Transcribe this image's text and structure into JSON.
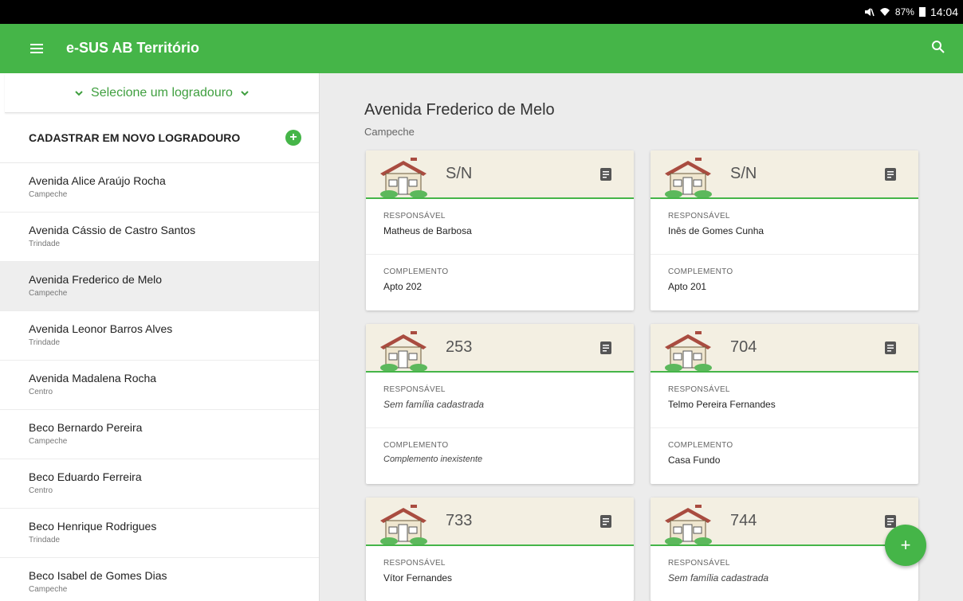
{
  "status": {
    "battery": "87%",
    "time": "14:04"
  },
  "appbar": {
    "title": "e-SUS AB Território"
  },
  "sidebar": {
    "selector_label": "Selecione um logradouro",
    "new_label": "CADASTRAR EM NOVO LOGRADOURO",
    "items": [
      {
        "name": "Avenida Alice Araújo Rocha",
        "sub": "Campeche"
      },
      {
        "name": "Avenida Cássio de Castro Santos",
        "sub": "Trindade"
      },
      {
        "name": "Avenida Frederico de Melo",
        "sub": "Campeche"
      },
      {
        "name": "Avenida Leonor Barros Alves",
        "sub": "Trindade"
      },
      {
        "name": "Avenida Madalena Rocha",
        "sub": "Centro"
      },
      {
        "name": "Beco Bernardo Pereira",
        "sub": "Campeche"
      },
      {
        "name": "Beco Eduardo Ferreira",
        "sub": "Centro"
      },
      {
        "name": "Beco Henrique Rodrigues",
        "sub": "Trindade"
      },
      {
        "name": "Beco Isabel de Gomes Dias",
        "sub": "Campeche"
      }
    ]
  },
  "main": {
    "title": "Avenida Frederico de Melo",
    "subtitle": "Campeche",
    "labels": {
      "responsible": "RESPONSÁVEL",
      "complement": "COMPLEMENTO"
    },
    "cards": [
      {
        "number": "S/N",
        "responsible": "Matheus de Barbosa",
        "complement": "Apto 202"
      },
      {
        "number": "S/N",
        "responsible": "Inês de Gomes Cunha",
        "complement": "Apto 201"
      },
      {
        "number": "253",
        "responsible": "Sem família cadastrada",
        "complement": "Complemento inexistente"
      },
      {
        "number": "704",
        "responsible": "Telmo Pereira Fernandes",
        "complement": "Casa Fundo"
      },
      {
        "number": "733",
        "responsible": "Vítor Fernandes",
        "complement": ""
      },
      {
        "number": "744",
        "responsible": "Sem família cadastrada",
        "complement": ""
      }
    ]
  },
  "fab": {
    "label": "+"
  },
  "colors": {
    "primary": "#45b548",
    "house_roof": "#a94c40",
    "card_header": "#f3efe2"
  }
}
